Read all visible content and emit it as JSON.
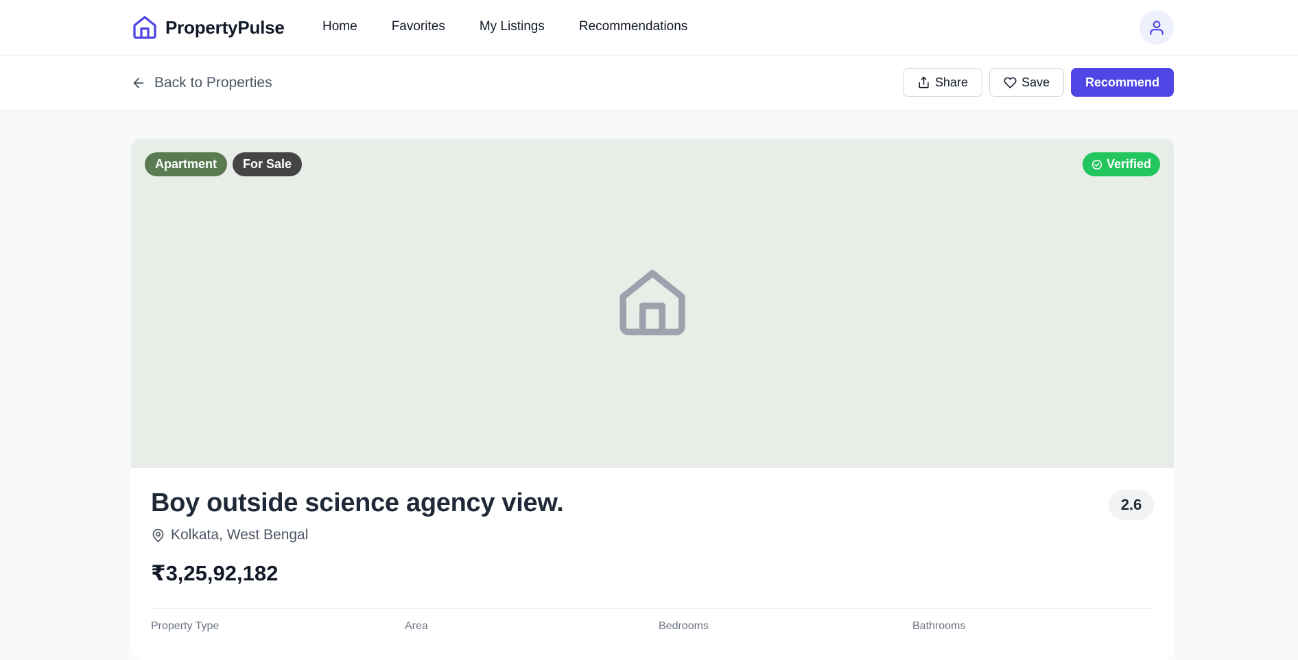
{
  "nav": {
    "brand": "PropertyPulse",
    "links": [
      "Home",
      "Favorites",
      "My Listings",
      "Recommendations"
    ],
    "brand_color": "#4f46e5"
  },
  "subheader": {
    "back_label": "Back to Properties",
    "share_label": "Share",
    "save_label": "Save",
    "recommend_label": "Recommend"
  },
  "property": {
    "type_badge": "Apartment",
    "status_badge": "For Sale",
    "verified_badge": "Verified",
    "title": "Boy outside science agency view.",
    "rating": "2.6",
    "location": "Kolkata, West Bengal",
    "price": "₹3,25,92,182",
    "stat_labels": [
      "Property Type",
      "Area",
      "Bedrooms",
      "Bathrooms"
    ]
  },
  "colors": {
    "accent": "#4f46e5",
    "verified": "#22c55e",
    "type_badge": "#5a7a52",
    "status_badge": "#444444",
    "hero_bg": "#e9ede8"
  }
}
